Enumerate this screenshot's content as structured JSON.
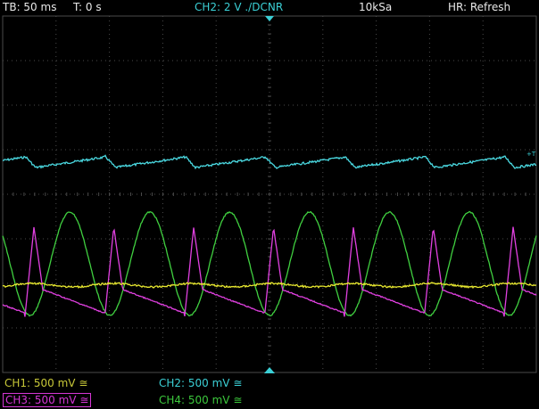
{
  "topbar": {
    "timebase": "TB: 50 ms",
    "trigger_time": "T: 0 s",
    "channel": "CH2: 2 V ./DCNR",
    "sample_rate": "10kSa",
    "mode": "HR: Refresh"
  },
  "trigger_marker": "+T",
  "channels": [
    {
      "label": "CH1: 500 mV ≅",
      "color": "#c8c838",
      "selected": false
    },
    {
      "label": "CH2: 500 mV ≅",
      "color": "#3bd0d6",
      "selected": false
    },
    {
      "label": "CH3: 500 mV ≅",
      "color": "#d637d6",
      "selected": true
    },
    {
      "label": "CH4: 500 mV ≅",
      "color": "#3cc83c",
      "selected": false
    }
  ],
  "colors": {
    "ch1": "#e8e830",
    "ch2": "#4ad8e0",
    "ch3": "#e040e0",
    "ch4": "#40d040",
    "grid": "#4a4a4a",
    "marker": "#3bd0d6"
  },
  "chart_data": {
    "type": "line",
    "title": "",
    "xlabel": "",
    "ylabel": "",
    "grid": true,
    "x_divisions": 10,
    "y_divisions": 8,
    "series": [
      {
        "name": "CH2",
        "color": "#4ad8e0",
        "description": "slow sawtooth-like ramp with dips"
      },
      {
        "name": "CH4",
        "color": "#40d040",
        "description": "sinusoid"
      },
      {
        "name": "CH3",
        "color": "#e040e0",
        "description": "sharp pulses with decaying tail"
      },
      {
        "name": "CH1",
        "color": "#e8e830",
        "description": "near-flat noisy line"
      }
    ]
  }
}
